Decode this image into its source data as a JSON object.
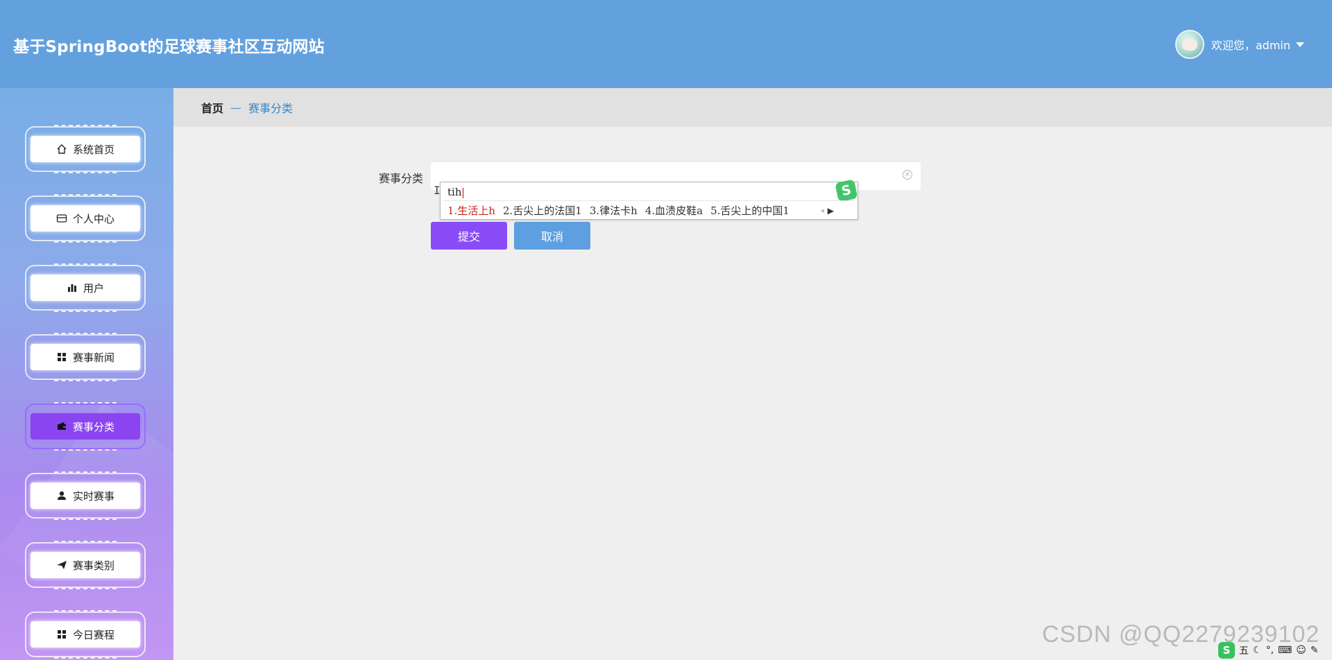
{
  "header": {
    "title": "基于SpringBoot的足球赛事社区互动网站",
    "welcome": "欢迎您，admin",
    "colors": {
      "header_bg": "#62a1de",
      "accent_purple": "#8a4cf7",
      "accent_blue": "#5d9fe0"
    }
  },
  "sidebar": {
    "items": [
      {
        "label": "系统首页",
        "icon": "home-icon"
      },
      {
        "label": "个人中心",
        "icon": "id-card-icon"
      },
      {
        "label": "用户",
        "icon": "bar-chart-icon"
      },
      {
        "label": "赛事新闻",
        "icon": "grid-icon"
      },
      {
        "label": "赛事分类",
        "icon": "wallet-icon",
        "active": true
      },
      {
        "label": "实时赛事",
        "icon": "user-icon"
      },
      {
        "label": "赛事类别",
        "icon": "paper-plane-icon"
      },
      {
        "label": "今日赛程",
        "icon": "grid-icon"
      }
    ]
  },
  "breadcrumb": {
    "home": "首页",
    "separator": "—",
    "current": "赛事分类"
  },
  "form": {
    "label": "赛事分类",
    "value": "",
    "submit": "提交",
    "cancel": "取消"
  },
  "ime": {
    "composition": "tih",
    "candidates": [
      "1.生活上h",
      "2.舌尖上的法国1",
      "3.律法卡h",
      "4.血渍皮鞋a",
      "5.舌尖上的中国1"
    ],
    "logo": "S"
  },
  "watermark": "CSDN @QQ2279239102",
  "tray": {
    "logo": "S",
    "ime_mode": "五"
  }
}
